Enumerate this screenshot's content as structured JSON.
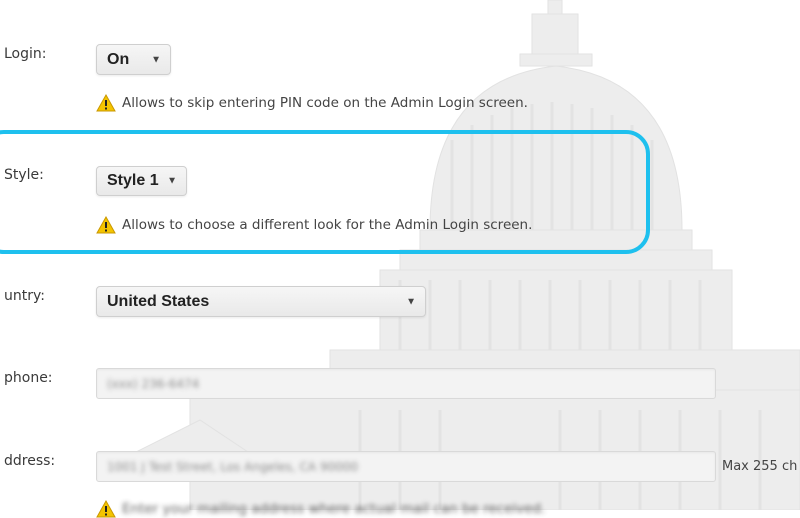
{
  "colors": {
    "highlight": "#1ec0ee",
    "warning": "#f4c400"
  },
  "login": {
    "label": "Login:",
    "value": "On",
    "hint": "Allows to skip entering PIN code on the Admin Login screen."
  },
  "style": {
    "label": "Style:",
    "value": "Style 1",
    "hint": "Allows to choose a different look for the Admin Login screen."
  },
  "country": {
    "label": "untry:",
    "value": "United States"
  },
  "phone": {
    "label": "phone:",
    "value": "(xxx) 236-6474"
  },
  "address": {
    "label": "ddress:",
    "value": "1001 J Test Street, Los Angeles, CA 90000",
    "max_note": "Max 255 ch",
    "hint": "Enter your mailing address where actual mail can be received."
  },
  "icons": {
    "warning": "warning-triangle-icon",
    "dropdown": "chevron-down-icon"
  }
}
